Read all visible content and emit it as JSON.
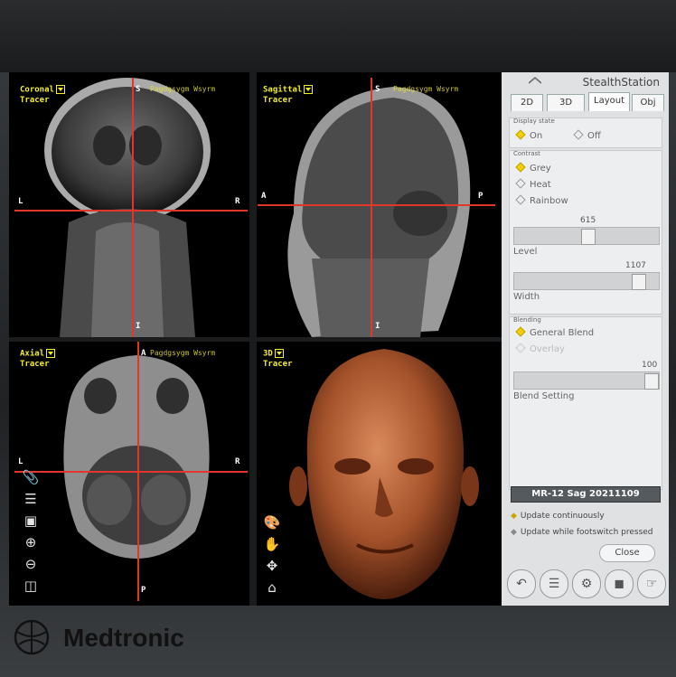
{
  "viewports": {
    "coronal": {
      "view": "Coronal",
      "tool": "Tracer",
      "patient": "Pagdgsygm Wsyrm",
      "top": "S",
      "left": "L",
      "right": "R",
      "bottom": "I"
    },
    "sagittal": {
      "view": "Sagittal",
      "tool": "Tracer",
      "patient": "Pagdgsygm Wsyrm",
      "top": "S",
      "left": "A",
      "right": "P",
      "bottom": "I"
    },
    "axial": {
      "view": "Axial",
      "tool": "Tracer",
      "patient": "Pagdgsygm Wsyrm",
      "top": "A",
      "left": "L",
      "right": "R",
      "bottom": "P"
    },
    "volume": {
      "view": "3D",
      "tool": "Tracer"
    }
  },
  "panel": {
    "brand": "StealthStation",
    "tabs": [
      "2D",
      "3D",
      "Layout",
      "Obj"
    ],
    "active_tab": "Layout",
    "display_state": {
      "title": "Display state",
      "on": "On",
      "off": "Off"
    },
    "contrast": {
      "title": "Contrast",
      "grey": "Grey",
      "heat": "Heat",
      "rainbow": "Rainbow"
    },
    "level": {
      "label": "Level",
      "value": "615"
    },
    "width": {
      "label": "Width",
      "value": "1107"
    },
    "blending": {
      "title": "Blending",
      "general": "General Blend",
      "overlay": "Overlay",
      "setting_label": "Blend Setting",
      "setting_value": "100"
    },
    "series": "MR-12 Sag 20211109",
    "update_continuously": "Update continuously",
    "update_footswitch": "Update while footswitch pressed",
    "close": "Close"
  },
  "bezel": {
    "logo": "Medtronic"
  },
  "colors": {
    "crosshair": "#e2362c",
    "label": "#f4ee2a",
    "accent": "#f0d000",
    "skin": "#a4522a"
  },
  "icons": {
    "left_tools": [
      "paperclip-icon",
      "list-icon",
      "layers-icon",
      "zoom-in-icon",
      "zoom-out-icon",
      "window-icon"
    ],
    "volume_tools": [
      "palette-icon",
      "hand-icon",
      "move-icon",
      "home-icon"
    ],
    "bottom": [
      "back-icon",
      "checklist-icon",
      "tools-icon",
      "camera-icon",
      "touch-icon"
    ]
  }
}
